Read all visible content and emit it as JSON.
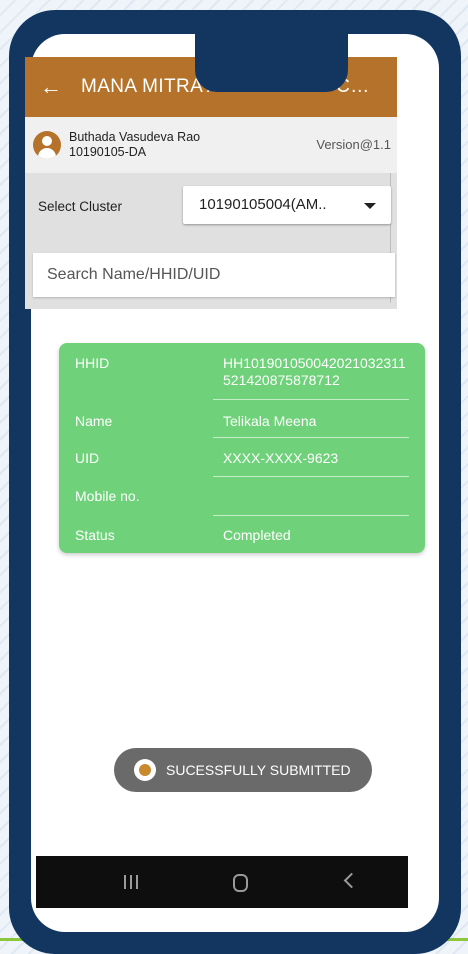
{
  "header": {
    "back_icon": "arrow-left-icon",
    "title": "MANA MITRA AWARENESS CAM..."
  },
  "user": {
    "name": "Buthada Vasudeva Rao",
    "id": "10190105-DA",
    "version": "Version@1.1"
  },
  "filter": {
    "cluster_label": "Select Cluster",
    "cluster_value": "10190105004(AM..",
    "search_placeholder": "Search Name/HHID/UID"
  },
  "record": {
    "hhid_label": "HHID",
    "hhid_value": "HH1019010500420210323115214208758787​12",
    "name_label": "Name",
    "name_value": "Telikala Meena",
    "uid_label": "UID",
    "uid_value": "XXXX-XXXX-9623",
    "mobile_label": "Mobile no.",
    "mobile_value": "",
    "status_label": "Status",
    "status_value": "Completed"
  },
  "toast": {
    "message": "SUCESSFULLY SUBMITTED"
  },
  "navbar": {
    "recents_icon": "recents-icon",
    "home_icon": "home-icon",
    "back_icon": "back-icon"
  },
  "colors": {
    "header": "#b5722a",
    "card": "#6fd27a",
    "frame": "#123660"
  }
}
